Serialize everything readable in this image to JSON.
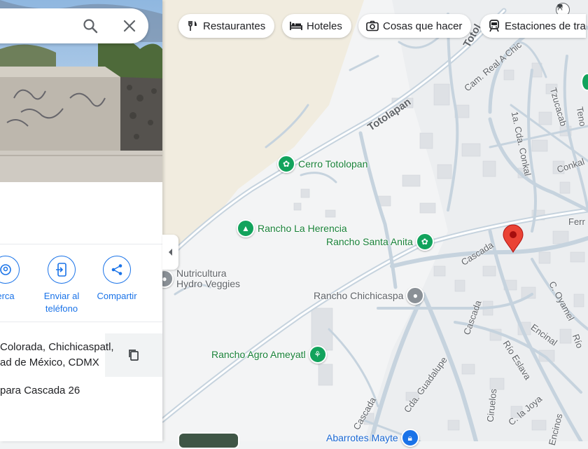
{
  "chips": [
    {
      "label": "Restaurantes",
      "icon": "fork-knife-icon"
    },
    {
      "label": "Hoteles",
      "icon": "bed-icon"
    },
    {
      "label": "Cosas que hacer",
      "icon": "camera-icon"
    },
    {
      "label": "Estaciones de tra",
      "icon": "train-icon"
    }
  ],
  "places": {
    "cerro_totolopan": "Cerro Totolopan",
    "rancho_la_herencia": "Rancho La Herencia",
    "rancho_santa_anita": "Rancho Santa Anita",
    "nutricultura": "Nutricultura",
    "hydro_veggies": "Hydro Veggies",
    "rancho_chichicaspa": "Rancho Chichicaspa",
    "rancho_agro_ameyatl": "Rancho Agro Ameyatl",
    "abarrotes_mayte": "Abarrotes Mayte"
  },
  "streets": {
    "totolapan_main": "Totolapan",
    "totol_top": "Totol",
    "cam_real": "Cam. Real A Chic",
    "tzucacab": "Tzucacab",
    "cda_conkal": "1a. Cda. Conkal",
    "conkal": "Conkal",
    "teno": "Teno",
    "ferr": "Ferr",
    "cascada_1": "Cascada",
    "cascada_2": "Cascada",
    "cascada_3": "Cascada",
    "c_oyamel": "C. Oyamel",
    "encinal": "Encinal",
    "rio_eslava": "Río Eslava",
    "cda_guadalupe": "Cda. Guadalupe",
    "ciruelos": "Ciruelos",
    "c_la_joya": "C. la Joya",
    "encinos": "Encinos",
    "rio": "Río"
  },
  "panel": {
    "actions": [
      {
        "label": "erca",
        "icon": "nearby-icon"
      },
      {
        "label": "Enviar al teléfono",
        "icon": "send-to-phone-icon"
      },
      {
        "label": "Compartir",
        "icon": "share-icon"
      }
    ],
    "address_line1": "Colorada, Chichicaspatl,",
    "address_line2": "ad de México, CDMX",
    "plus_code": "para Cascada 26"
  },
  "colors": {
    "accent": "#1a73e8",
    "marker": "#ea4335",
    "park_green": "#12a35c",
    "map_land": "#f1f3f4",
    "map_road": "#c6d3de"
  }
}
